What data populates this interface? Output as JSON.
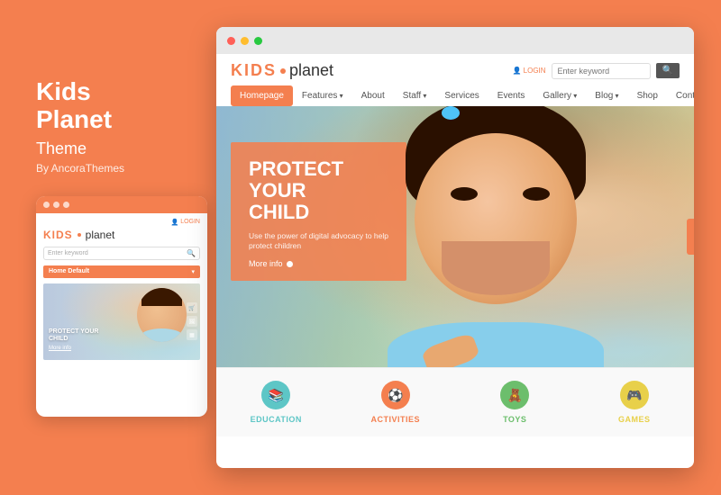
{
  "left": {
    "title": "Kids\nPlanet",
    "subtitle": "Theme",
    "by": "By AncoraThemes"
  },
  "mobile": {
    "login": "LOGIN",
    "logo_kids": "KIDS",
    "logo_planet": "planet",
    "search_placeholder": "Enter keyword",
    "nav_label": "Home Default",
    "hero_text": "PROTECT YOUR\nCHILD",
    "hero_link": "More info"
  },
  "browser": {
    "dots": [
      "●",
      "●",
      "●"
    ]
  },
  "site": {
    "logo_kids": "KIDS",
    "logo_planet": "planet",
    "login": "LOGIN",
    "search_placeholder": "Enter keyword",
    "nav_items": [
      {
        "label": "Homepage",
        "active": true
      },
      {
        "label": "Features",
        "arrow": true
      },
      {
        "label": "About"
      },
      {
        "label": "Staff",
        "arrow": true
      },
      {
        "label": "Services"
      },
      {
        "label": "Events"
      },
      {
        "label": "Gallery",
        "arrow": true
      },
      {
        "label": "Blog",
        "arrow": true
      },
      {
        "label": "Shop"
      },
      {
        "label": "Contacts"
      }
    ],
    "hero_title": "PROTECT YOUR\nCHILD",
    "hero_desc": "Use the power of digital advocacy to help protect children",
    "hero_link": "More info",
    "categories": [
      {
        "label": "EDUCATION",
        "icon": "📚",
        "color": "cat-education",
        "label_color": "cat-education-label"
      },
      {
        "label": "ACTIVITIES",
        "icon": "⚽",
        "color": "cat-activities",
        "label_color": "cat-activities-label"
      },
      {
        "label": "TOYS",
        "icon": "🧸",
        "color": "cat-toys",
        "label_color": "cat-toys-label"
      },
      {
        "label": "GAMES",
        "icon": "🎮",
        "color": "cat-games",
        "label_color": "cat-games-label"
      }
    ]
  }
}
